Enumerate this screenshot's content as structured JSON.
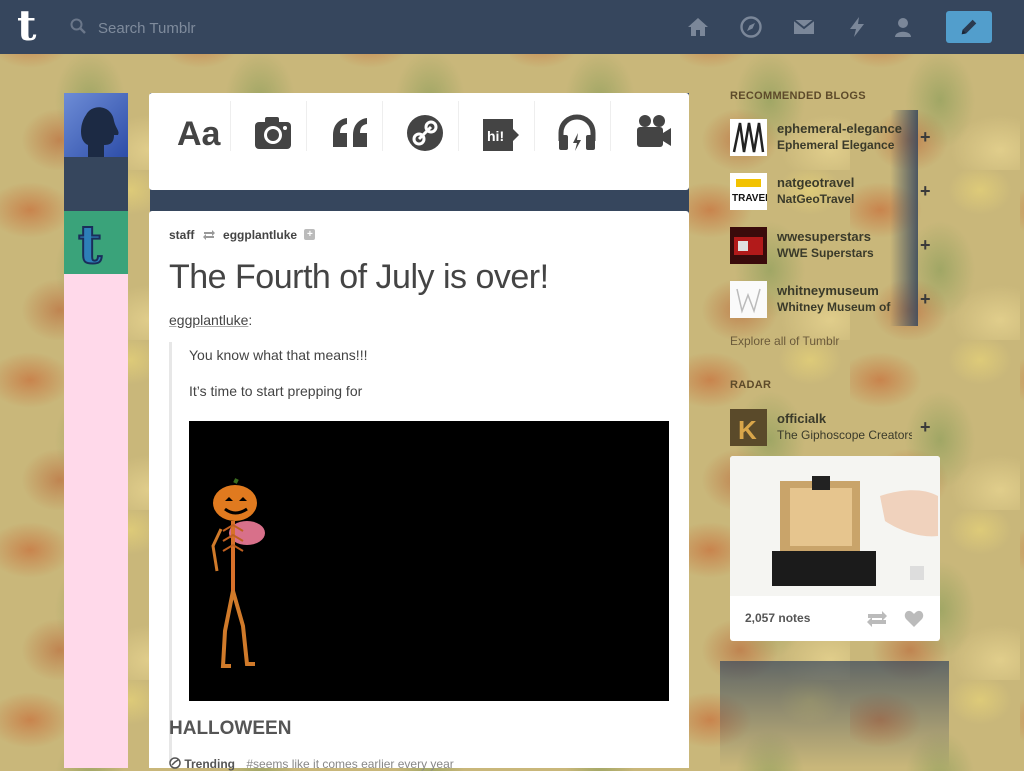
{
  "header": {
    "logo": "t",
    "search_placeholder": "Search Tumblr",
    "nav_icons": [
      "home-icon",
      "explore-icon",
      "messages-icon",
      "activity-icon",
      "account-icon"
    ],
    "compose_icon": "pencil-icon",
    "compose_color": "#529ecc",
    "bar_color": "#36465d"
  },
  "composer": {
    "types": [
      {
        "name": "text",
        "label": "Aa"
      },
      {
        "name": "photo",
        "label": ""
      },
      {
        "name": "quote",
        "label": "“"
      },
      {
        "name": "link",
        "label": ""
      },
      {
        "name": "chat",
        "label": "hi!"
      },
      {
        "name": "audio",
        "label": ""
      },
      {
        "name": "video",
        "label": ""
      }
    ]
  },
  "post": {
    "author": "staff",
    "reblogged_from": "eggplantluke",
    "follow": "+",
    "title": "The Fourth of July is over!",
    "source_user": "eggplantluke",
    "source_colon": ":",
    "quote_line1": "You know what that means!!!",
    "quote_line2": "It’s time to start prepping for",
    "heading": "HALLOWEEN",
    "footer_label": "Trending",
    "footer_tag": "#seems like it comes earlier every year"
  },
  "sidebar": {
    "recommended_title": "RECOMMENDED BLOGS",
    "blogs": [
      {
        "name": "ephemeral-elegance",
        "desc": "Ephemeral Elegance"
      },
      {
        "name": "natgeotravel",
        "desc": "NatGeoTravel"
      },
      {
        "name": "wwesuperstars",
        "desc": "WWE Superstars"
      },
      {
        "name": "whitneymuseum",
        "desc": "Whitney Museum of"
      }
    ],
    "plus": "+",
    "explore": "Explore all of Tumblr",
    "radar_title": "RADAR",
    "radar_blog": {
      "name": "officialk",
      "desc": "The Giphoscope Creators"
    },
    "radar_notes": "2,057 notes"
  }
}
